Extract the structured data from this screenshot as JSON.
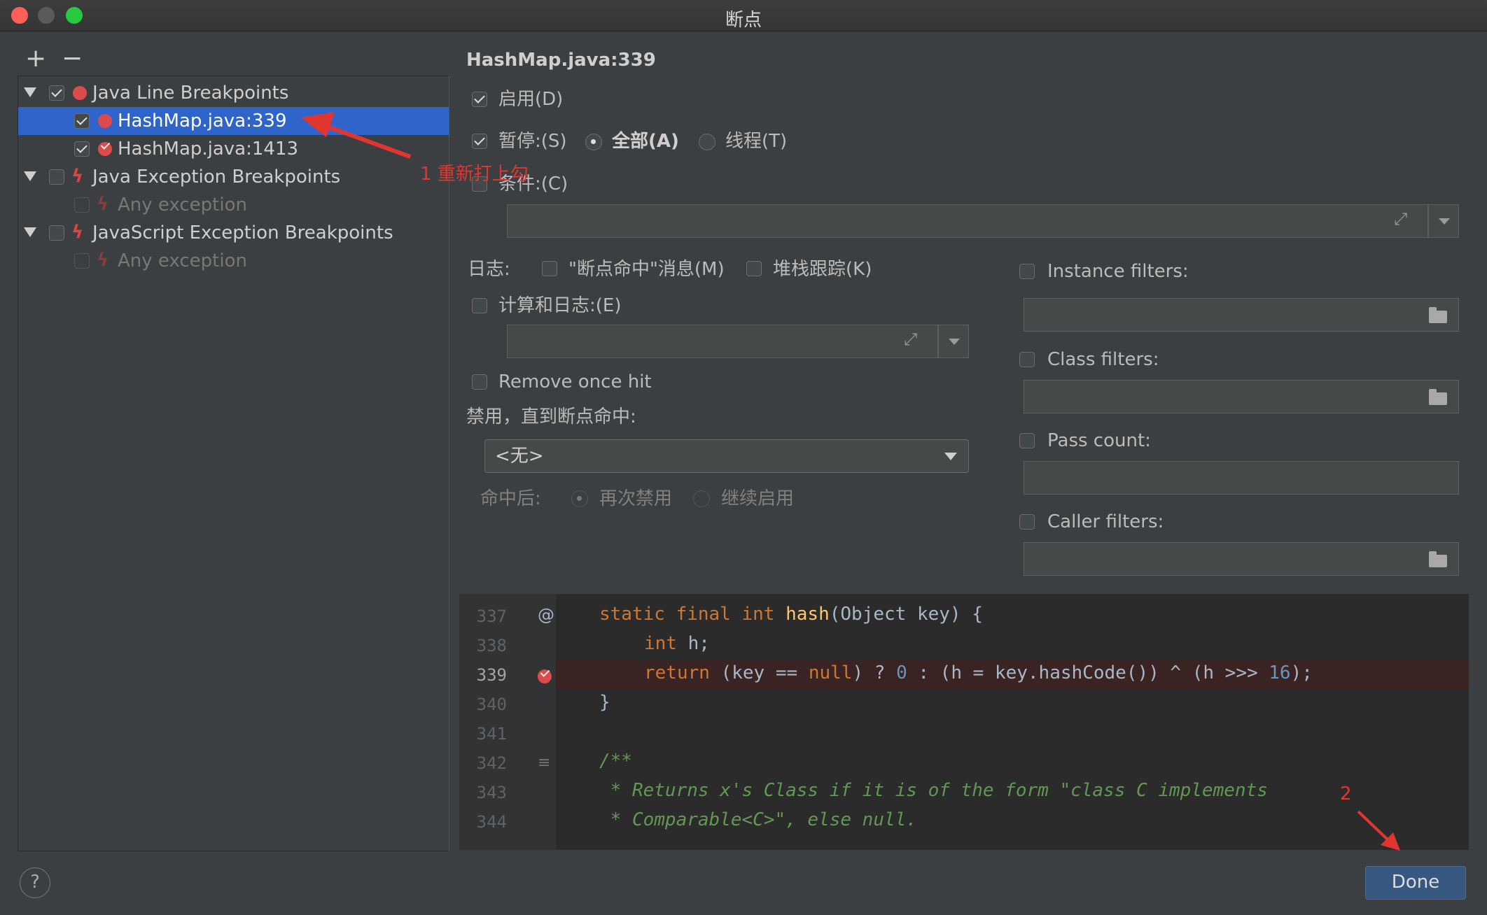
{
  "window": {
    "title": "断点",
    "colors": {
      "close": "#fe5f57",
      "minimize": "#5b5b5b",
      "zoom": "#27c93f"
    }
  },
  "toolbar": {
    "add_label": "+",
    "remove_label": "−"
  },
  "tree": {
    "groups": [
      {
        "label": "Java Line Breakpoints",
        "checked": true
      },
      {
        "label": "Java Exception Breakpoints",
        "checked": false
      },
      {
        "label": "JavaScript Exception Breakpoints",
        "checked": false
      }
    ],
    "items": [
      {
        "label": "HashMap.java:339",
        "checked": true,
        "selected": true
      },
      {
        "label": "HashMap.java:1413",
        "checked": true
      },
      {
        "label": "Any exception",
        "checked": false
      },
      {
        "label": "Any exception",
        "checked": false
      }
    ]
  },
  "details": {
    "heading": "HashMap.java:339",
    "enabled_label": "启用(D)",
    "suspend_label": "暂停:(S)",
    "suspend_all_label": "全部(A)",
    "suspend_thread_label": "线程(T)",
    "condition_label": "条件:(C)",
    "log_label": "日志:",
    "log_message_label": "\"断点命中\"消息(M)",
    "log_stack_label": "堆栈跟踪(K)",
    "evaluate_log_label": "计算和日志:(E)",
    "remove_once_label": "Remove once hit",
    "disable_until_label": "禁用，直到断点命中:",
    "disable_until_value": "<无>",
    "after_hit_label": "命中后:",
    "after_hit_disable_label": "再次禁用",
    "after_hit_enable_label": "继续启用"
  },
  "filters": {
    "instance_label": "Instance filters:",
    "class_label": "Class filters:",
    "pass_count_label": "Pass count:",
    "caller_label": "Caller filters:"
  },
  "editor": {
    "line_numbers": [
      "337",
      "338",
      "339",
      "340",
      "341",
      "342",
      "343",
      "344"
    ],
    "current_line": "339",
    "gutter_at": "@",
    "code": {
      "l337_kw": "static final int ",
      "l337_fn": "hash",
      "l337_rest": "(Object key) {",
      "l338_kw": "int ",
      "l338_rest": "h;",
      "l339_kw": "return ",
      "l339_a": "(key == ",
      "l339_null": "null",
      "l339_b": ") ? ",
      "l339_zero": "0",
      "l339_c": " : (h = key.hashCode()) ^ (h >>> ",
      "l339_sixteen": "16",
      "l339_d": ");",
      "l340": "}",
      "l342": "/**",
      "l343": " * Returns x's Class if it is of the form \"class C implements",
      "l344": " * Comparable<C>\", else null."
    }
  },
  "footer": {
    "help_label": "?",
    "done_label": "Done"
  },
  "annotations": {
    "note1": "1 重新打上勾",
    "note2": "2"
  }
}
